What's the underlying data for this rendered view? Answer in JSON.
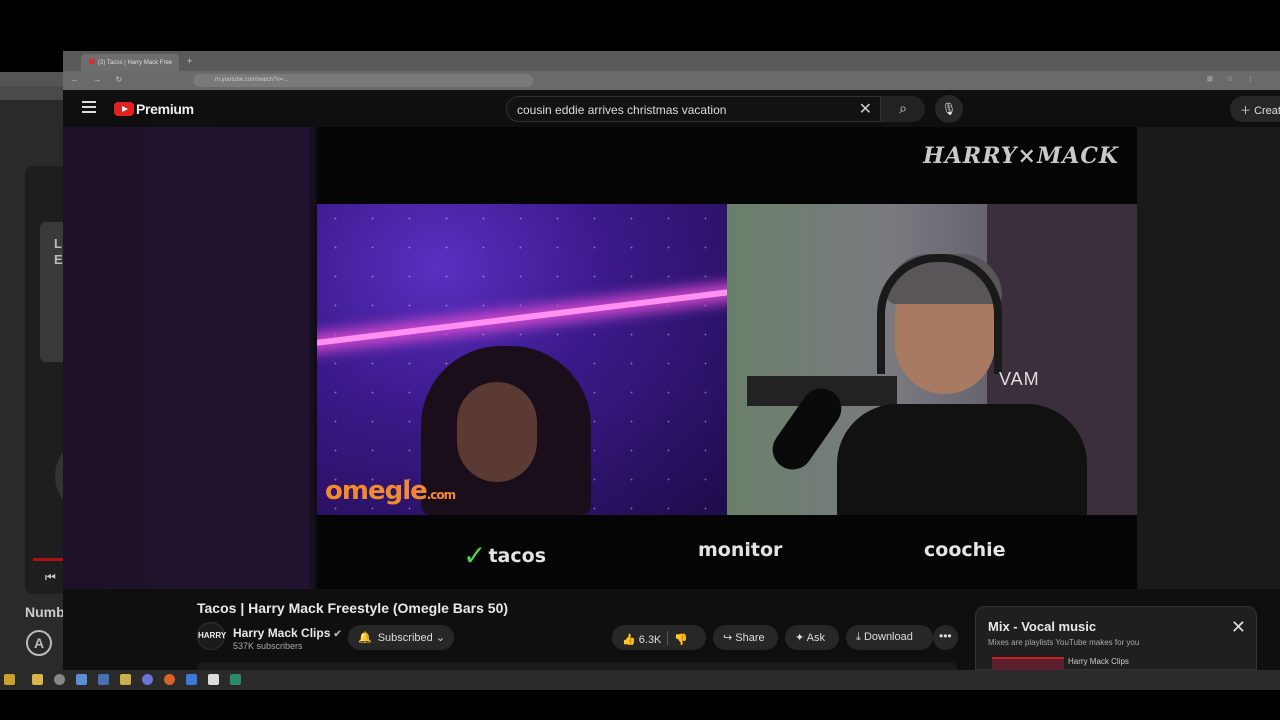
{
  "browser": {
    "tab_title": "(2) Tacos | Harry Mack Free",
    "new_tab": "+",
    "nav_icons": "← → ↻",
    "url": "m.youtube.com/watch?v=...",
    "right_icons": "⊞ ☆ ⋮"
  },
  "youtube": {
    "logo_text": "Premium",
    "search_query": "cousin eddie arrives christmas vacation",
    "create_label": "Creat"
  },
  "video": {
    "watermark": "HARRY×MACK",
    "omegle_logo": "omegle",
    "omegle_suffix": ".com",
    "vam_text": "VAM",
    "words": [
      "tacos",
      "monitor",
      "coochie"
    ]
  },
  "meta": {
    "title": "Tacos | Harry Mack Freestyle (Omegle Bars 50)",
    "channel_avatar": "HARRY",
    "channel_name": "Harry Mack Clips",
    "subscribers": "537K subscribers",
    "subscribed_label": "Subscribed",
    "likes": "6.3K",
    "share_label": "Share",
    "ask_label": "Ask",
    "download_label": "Download"
  },
  "mix": {
    "title": "Mix - Vocal music",
    "subtitle": "Mixes are playlists YouTube makes for you",
    "channel": "Harry Mack Clips"
  },
  "background_window": {
    "card_letters": "L\nE",
    "title_fragment": "Numb"
  },
  "colors": {
    "youtube_red": "#e32020",
    "check_green": "#48d44a",
    "omegle_orange": "#f28a2e"
  }
}
